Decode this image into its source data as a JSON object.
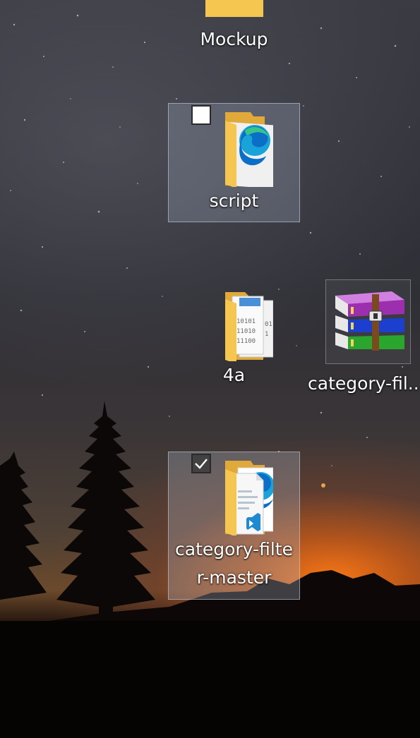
{
  "desktop": {
    "icons": [
      {
        "label": "Mockup",
        "icon": "folder-icon"
      },
      {
        "label": "script",
        "icon": "folder-edge-icon"
      },
      {
        "label": "4a",
        "icon": "folder-binary-icon"
      },
      {
        "label": "category-fil...",
        "icon": "winrar-archive-icon"
      },
      {
        "label": "category-filte",
        "label_line2": "r-master",
        "icon": "folder-vscode-edge-icon",
        "checked": true
      }
    ]
  },
  "colors": {
    "folder_yellow": "#f5c650",
    "folder_back": "#e0a93a",
    "edge_blue": "#0c6fc7",
    "edge_green": "#37c48b",
    "vscode_blue": "#1f8ad2",
    "winrar_purple": "#9b2fae",
    "winrar_blue": "#1d3fcf",
    "winrar_green": "#2aa52d",
    "sunset_orange": "#f07a1e"
  }
}
